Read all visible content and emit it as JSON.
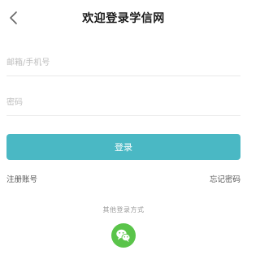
{
  "header": {
    "back_icon": "chevron-left-icon",
    "title": "欢迎登录学信网"
  },
  "form": {
    "account_placeholder": "邮箱/手机号",
    "account_value": "",
    "password_placeholder": "密码",
    "password_value": "",
    "login_label": "登录"
  },
  "links": {
    "register": "注册账号",
    "forgot_password": "忘记密码"
  },
  "other_login": {
    "label": "其他登录方式",
    "wechat_icon": "wechat-icon"
  },
  "colors": {
    "accent": "#4ab8c4",
    "wechat": "#5ac44a",
    "divider": "#e9e9e9"
  }
}
